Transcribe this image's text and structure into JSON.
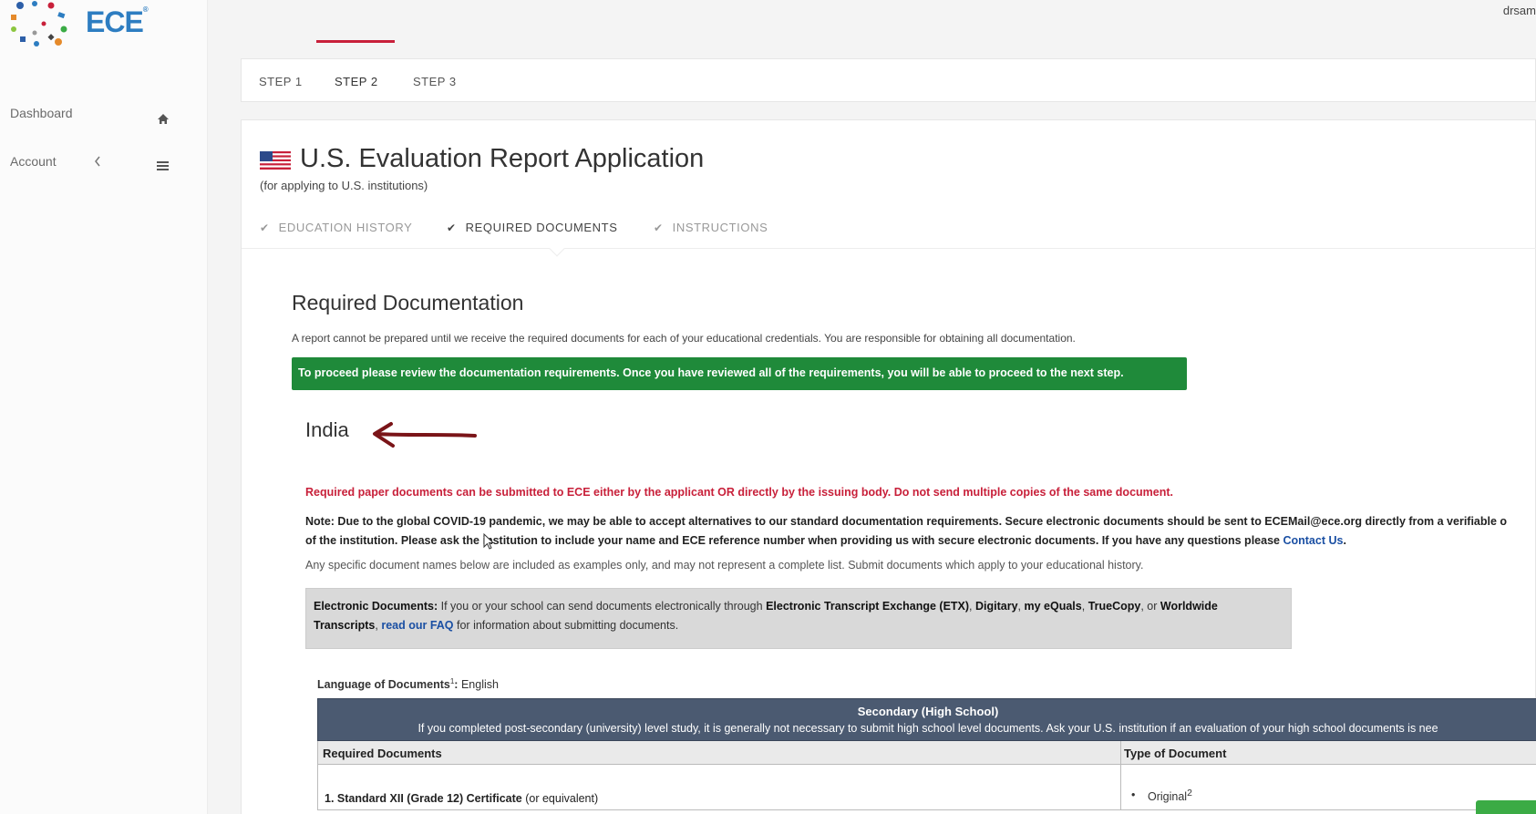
{
  "brand": {
    "name": "ECE",
    "mark": "®"
  },
  "user": {
    "name": "drsam"
  },
  "sidebar": {
    "items": [
      {
        "label": "Dashboard",
        "icon": "home-icon"
      },
      {
        "label": "Account",
        "icon": "menu-icon"
      }
    ]
  },
  "steps": [
    {
      "label": "STEP 1"
    },
    {
      "label": "STEP 2",
      "active": true
    },
    {
      "label": "STEP 3"
    }
  ],
  "application": {
    "title": "U.S. Evaluation Report Application",
    "subtitle": "(for applying to U.S. institutions)"
  },
  "substeps": [
    {
      "label": "EDUCATION HISTORY"
    },
    {
      "label": "REQUIRED DOCUMENTS",
      "active": true
    },
    {
      "label": "INSTRUCTIONS"
    }
  ],
  "required": {
    "title": "Required Documentation",
    "intro": "A report cannot be prepared until we receive the required documents for each of your educational credentials. You are responsible for obtaining all documentation.",
    "banner": "To proceed please review the documentation requirements. Once you have reviewed all of the requirements, you will be able to proceed to the next step.",
    "country": "India",
    "red_note": "Required paper documents can be submitted to ECE either by the applicant OR directly by the issuing body. Do not send multiple copies of the same document.",
    "covid_line1": "Note: Due to the global COVID-19 pandemic, we may be able to accept alternatives to our standard documentation requirements. Secure electronic documents should be sent to ECEMail@ece.org directly from a verifiable o",
    "covid_line2": "of the institution. Please ask the institution to include your name and ECE reference number when providing us with secure electronic documents. If you have any questions please ",
    "contact_link": "Contact Us",
    "examples": "Any specific document names below are included as examples only, and may not represent a complete list. Submit documents which apply to your educational history.",
    "edocs": {
      "label": "Electronic Documents:",
      "text1": " If you or your school can send documents electronically through ",
      "etx": "Electronic Transcript Exchange (ETX)",
      "digitary": "Digitary",
      "myequals": "my eQuals",
      "truecopy": "TrueCopy",
      "or": ", or ",
      "worldwide": "Worldwide Transcripts",
      "faq": "read our FAQ",
      "text2": " for information about submitting documents."
    },
    "language_label": "Language of Documents",
    "language_sup": "1",
    "language_value": "English"
  },
  "table": {
    "section_title": "Secondary (High School)",
    "section_note": "If you completed  post-secondary (university) level study, it is generally not necessary to submit high school level documents. Ask your U.S. institution if an evaluation of your high school documents is nee",
    "col1": "Required Documents",
    "col2": "Type of Document",
    "rows": [
      {
        "doc": "1. Standard XII (Grade 12) Certificate",
        "doc_suffix": "(or equivalent)",
        "type": "Original",
        "type_sup": "2"
      }
    ]
  }
}
